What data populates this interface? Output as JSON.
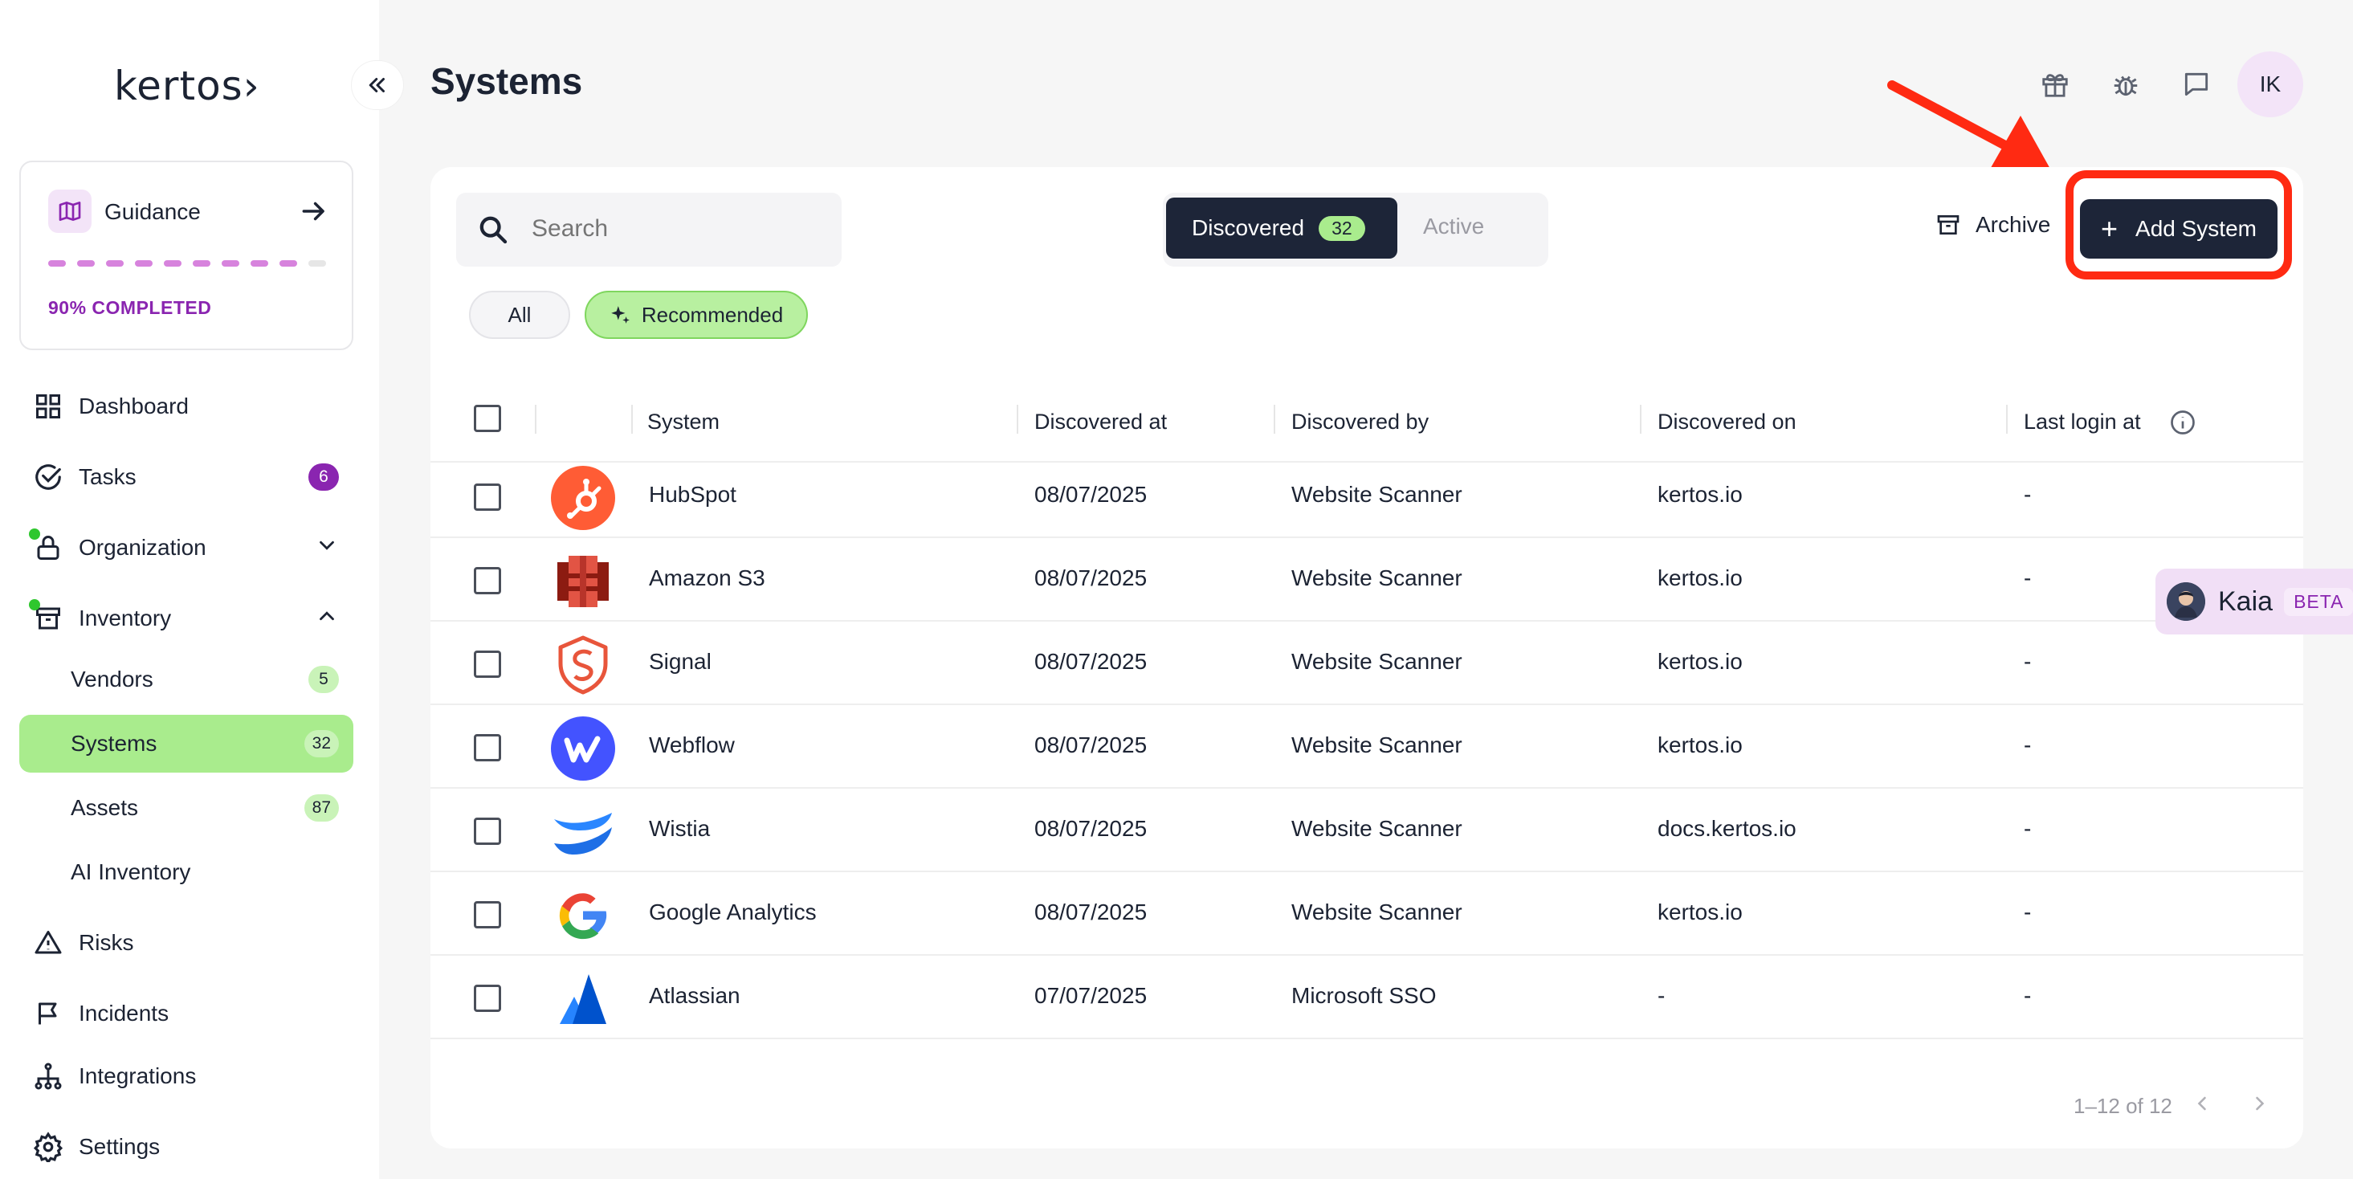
{
  "app": {
    "logo": "kertos›",
    "page_title": "Systems"
  },
  "guidance": {
    "label": "Guidance",
    "progress": "90% COMPLETED",
    "progress_fraction": 0.9
  },
  "sidebar": {
    "items": [
      {
        "label": "Dashboard",
        "icon": "grid-icon"
      },
      {
        "label": "Tasks",
        "icon": "check-circle-icon",
        "badge": "6"
      },
      {
        "label": "Organization",
        "icon": "lock-icon"
      },
      {
        "label": "Inventory",
        "icon": "archive-box-icon"
      },
      {
        "label": "Risks",
        "icon": "warning-icon"
      },
      {
        "label": "Incidents",
        "icon": "flag-icon"
      },
      {
        "label": "Integrations",
        "icon": "network-icon"
      },
      {
        "label": "Settings",
        "icon": "gear-icon"
      }
    ],
    "inventory_children": [
      {
        "label": "Vendors",
        "badge": "5"
      },
      {
        "label": "Systems",
        "badge": "32"
      },
      {
        "label": "Assets",
        "badge": "87"
      },
      {
        "label": "AI Inventory"
      }
    ]
  },
  "header": {
    "avatar_initials": "IK",
    "icons": [
      "gift-icon",
      "bug-icon",
      "chat-icon"
    ]
  },
  "toolbar": {
    "search_placeholder": "Search",
    "tab_discovered": "Discovered",
    "tab_discovered_count": "32",
    "tab_active": "Active",
    "archive_label": "Archive",
    "add_label": "Add System",
    "filter_all": "All",
    "filter_recommended": "Recommended"
  },
  "table": {
    "columns": [
      "System",
      "Discovered at",
      "Discovered by",
      "Discovered on",
      "Last login at"
    ],
    "rows": [
      {
        "system": "HubSpot",
        "discovered_at": "08/07/2025",
        "discovered_by": "Website Scanner",
        "discovered_on": "kertos.io",
        "last_login": "-",
        "logo": "hubspot-logo-icon"
      },
      {
        "system": "Amazon S3",
        "discovered_at": "08/07/2025",
        "discovered_by": "Website Scanner",
        "discovered_on": "kertos.io",
        "last_login": "-",
        "logo": "amazon-s3-logo-icon"
      },
      {
        "system": "Signal",
        "discovered_at": "08/07/2025",
        "discovered_by": "Website Scanner",
        "discovered_on": "kertos.io",
        "last_login": "-",
        "logo": "signal-logo-icon"
      },
      {
        "system": "Webflow",
        "discovered_at": "08/07/2025",
        "discovered_by": "Website Scanner",
        "discovered_on": "kertos.io",
        "last_login": "-",
        "logo": "webflow-logo-icon"
      },
      {
        "system": "Wistia",
        "discovered_at": "08/07/2025",
        "discovered_by": "Website Scanner",
        "discovered_on": "docs.kertos.io",
        "last_login": "-",
        "logo": "wistia-logo-icon"
      },
      {
        "system": "Google Analytics",
        "discovered_at": "08/07/2025",
        "discovered_by": "Website Scanner",
        "discovered_on": "kertos.io",
        "last_login": "-",
        "logo": "google-logo-icon"
      },
      {
        "system": "Atlassian",
        "discovered_at": "07/07/2025",
        "discovered_by": "Microsoft SSO",
        "discovered_on": "-",
        "last_login": "-",
        "logo": "atlassian-logo-icon"
      }
    ],
    "pagination": "1–12 of 12"
  },
  "assistant": {
    "name": "Kaia",
    "tag": "BETA"
  },
  "colors": {
    "primary_dark": "#1d2538",
    "accent_green": "#a9ec8d",
    "accent_purple": "#8a25b0",
    "annotation_red": "#ff2a12"
  }
}
